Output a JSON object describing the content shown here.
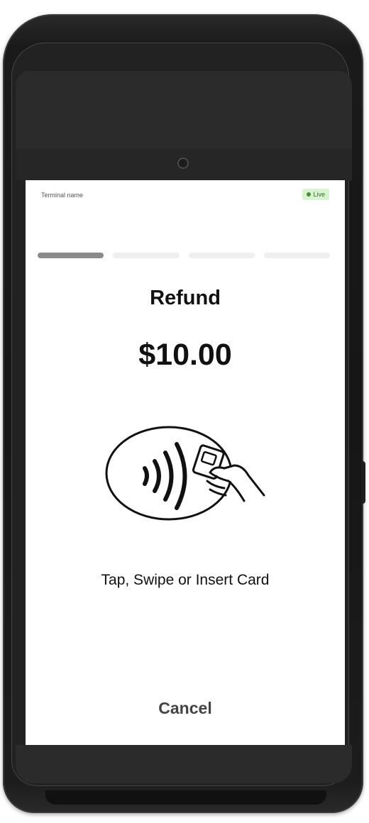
{
  "header": {
    "terminal_name": "Terminal name",
    "status_badge": "Live",
    "status_color": "#4c8a3c"
  },
  "progress": {
    "steps_total": 4,
    "current_step": 1
  },
  "transaction": {
    "type": "Refund",
    "amount": "$10.00"
  },
  "instruction": {
    "icon": "contactless-tap-card-icon",
    "text": "Tap, Swipe or Insert Card"
  },
  "actions": {
    "cancel_label": "Cancel"
  }
}
